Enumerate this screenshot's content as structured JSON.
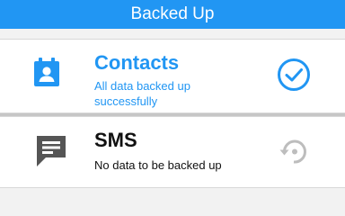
{
  "header": {
    "title": "Backed Up"
  },
  "items": [
    {
      "title": "Contacts",
      "subtitle": "All data backed up successfully",
      "left_icon": "contacts-icon",
      "right_icon": "check-circle-icon",
      "status": "backed-up",
      "accent": "#2196f3"
    },
    {
      "title": "SMS",
      "subtitle": "No data to be backed up",
      "left_icon": "sms-icon",
      "right_icon": "restore-icon",
      "status": "no-data",
      "accent": "#555555"
    }
  ],
  "colors": {
    "primary": "#2196f3",
    "muted_icon": "#bdbdbd",
    "dark_icon": "#555555"
  }
}
